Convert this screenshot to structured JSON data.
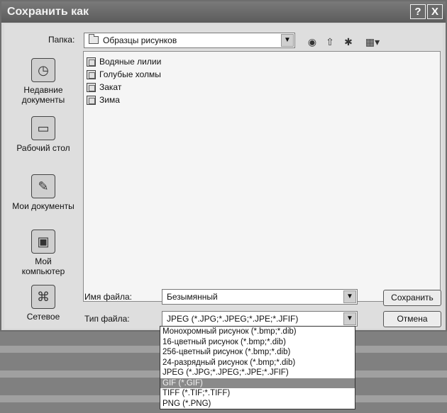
{
  "window": {
    "title": "Сохранить как",
    "help_button": "?",
    "close_button": "X"
  },
  "folder": {
    "label": "Папка:",
    "value": "Образцы рисунков"
  },
  "toolbar": {
    "back_icon": "back-icon",
    "up_icon": "up-folder-icon",
    "new_folder_icon": "new-folder-icon",
    "view_icon": "view-menu-icon"
  },
  "places": [
    {
      "label_line1": "Недавние",
      "label_line2": "документы",
      "icon": "recent-documents-icon"
    },
    {
      "label_line1": "Рабочий стол",
      "label_line2": "",
      "icon": "desktop-icon"
    },
    {
      "label_line1": "Мои документы",
      "label_line2": "",
      "icon": "my-documents-icon"
    },
    {
      "label_line1": "Мой",
      "label_line2": "компьютер",
      "icon": "my-computer-icon"
    },
    {
      "label_line1": "Сетевое",
      "label_line2": "",
      "icon": "network-icon"
    }
  ],
  "files": [
    "Водяные лилии",
    "Голубые холмы",
    "Закат",
    "Зима"
  ],
  "filename": {
    "label": "Имя файла:",
    "value": "Безымянный"
  },
  "filetype": {
    "label": "Тип файла:",
    "value": "JPEG (*.JPG;*.JPEG;*.JPE;*.JFIF)",
    "options": [
      "Монохромный рисунок (*.bmp;*.dib)",
      "16-цветный рисунок (*.bmp;*.dib)",
      "256-цветный рисунок (*.bmp;*.dib)",
      "24-разрядный рисунок (*.bmp;*.dib)",
      "JPEG (*.JPG;*.JPEG;*.JPE;*.JFIF)",
      "GIF (*.GIF)",
      "TIFF (*.TIF;*.TIFF)",
      "PNG (*.PNG)"
    ],
    "selected_option": "GIF (*.GIF)"
  },
  "buttons": {
    "save": "Сохранить",
    "cancel": "Отмена"
  }
}
